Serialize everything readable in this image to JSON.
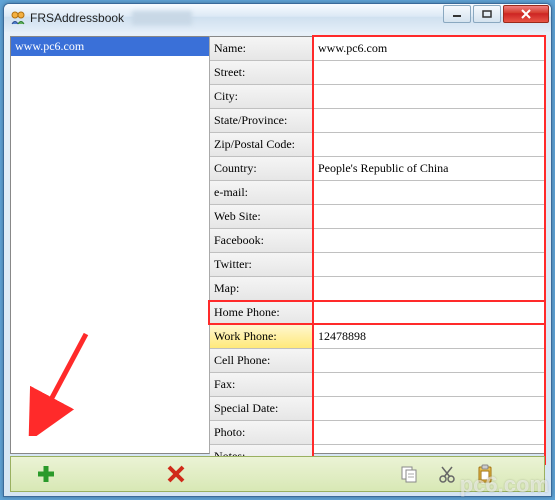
{
  "window": {
    "title": "FRSAddressbook"
  },
  "sidebar": {
    "selected": "www.pc6.com"
  },
  "fields": [
    {
      "label": "Name:",
      "value": "www.pc6.com",
      "active": false
    },
    {
      "label": "Street:",
      "value": "",
      "active": false
    },
    {
      "label": "City:",
      "value": "",
      "active": false
    },
    {
      "label": "State/Province:",
      "value": "",
      "active": false
    },
    {
      "label": "Zip/Postal Code:",
      "value": "",
      "active": false
    },
    {
      "label": "Country:",
      "value": "People's Republic of China",
      "active": false
    },
    {
      "label": "e-mail:",
      "value": "",
      "active": false
    },
    {
      "label": "Web Site:",
      "value": "",
      "active": false
    },
    {
      "label": "Facebook:",
      "value": "",
      "active": false
    },
    {
      "label": "Twitter:",
      "value": "",
      "active": false
    },
    {
      "label": "Map:",
      "value": "",
      "active": false
    },
    {
      "label": "Home Phone:",
      "value": "",
      "active": false
    },
    {
      "label": "Work Phone:",
      "value": "12478898",
      "active": true
    },
    {
      "label": "Cell Phone:",
      "value": "",
      "active": false
    },
    {
      "label": "Fax:",
      "value": "",
      "active": false
    },
    {
      "label": "Special Date:",
      "value": "",
      "active": false
    },
    {
      "label": "Photo:",
      "value": "",
      "active": false
    },
    {
      "label": "Notes:",
      "value": "",
      "active": false
    }
  ],
  "toolbar": {
    "add": "add-icon",
    "delete": "delete-icon",
    "copy": "copy-icon",
    "cut": "cut-icon",
    "paste": "paste-icon"
  },
  "watermark": "pc6.com"
}
